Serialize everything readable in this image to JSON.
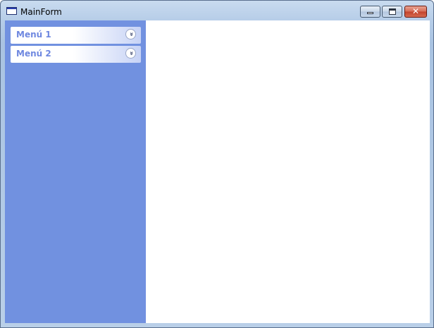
{
  "window": {
    "title": "MainForm",
    "icon": "window-icon",
    "controls": {
      "minimize_icon": "minimize-icon",
      "maximize_icon": "maximize-icon",
      "close_glyph": "✕"
    }
  },
  "sidebar": {
    "background": "#7191e0",
    "menus": [
      {
        "label": "Menú 1",
        "expand_glyph": "»",
        "icon": "chevron-double-down-icon"
      },
      {
        "label": "Menú 2",
        "expand_glyph": "»",
        "icon": "chevron-double-down-icon"
      }
    ]
  },
  "colors": {
    "menu_label": "#6f88e0",
    "close_button": "#c2412b"
  }
}
